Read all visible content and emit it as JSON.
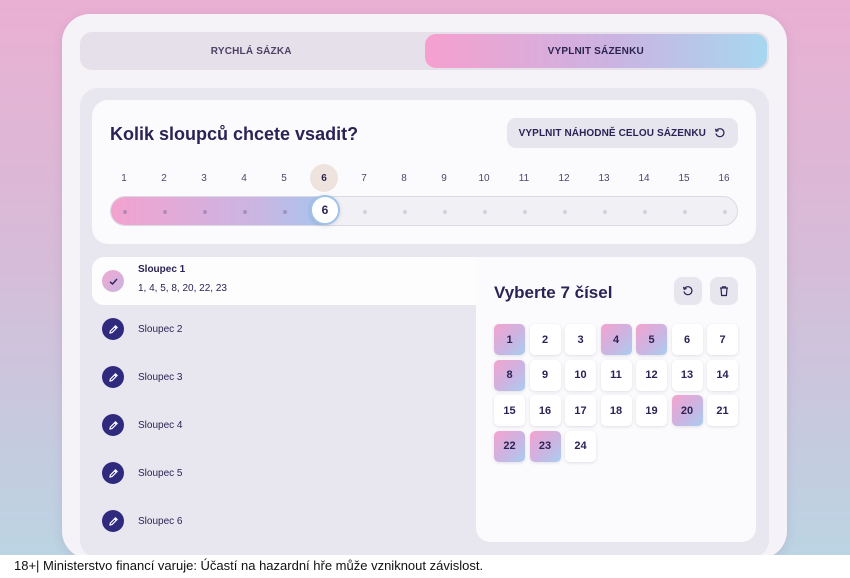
{
  "tabs": [
    {
      "label": "RYCHLÁ SÁZKA",
      "active": false
    },
    {
      "label": "VYPLNIT SÁZENKU",
      "active": true
    }
  ],
  "columns_question": {
    "title": "Kolik sloupců chcete vsadit?",
    "random_button": "VYPLNIT NÁHODNĚ CELOU SÁZENKU",
    "numbers": [
      "1",
      "2",
      "3",
      "4",
      "5",
      "6",
      "7",
      "8",
      "9",
      "10",
      "11",
      "12",
      "13",
      "14",
      "15",
      "16"
    ],
    "selected": 6,
    "selected_label": "6",
    "max": 16
  },
  "column_items": [
    {
      "name": "Sloupec 1",
      "numbers": "1, 4, 5, 8, 20, 22, 23",
      "state": "done",
      "icon": "check-icon"
    },
    {
      "name": "Sloupec 2",
      "state": "edit",
      "icon": "pencil-icon"
    },
    {
      "name": "Sloupec 3",
      "state": "edit",
      "icon": "pencil-icon"
    },
    {
      "name": "Sloupec 4",
      "state": "edit",
      "icon": "pencil-icon"
    },
    {
      "name": "Sloupec 5",
      "state": "edit",
      "icon": "pencil-icon"
    },
    {
      "name": "Sloupec 6",
      "state": "edit",
      "icon": "pencil-icon"
    }
  ],
  "picker": {
    "title": "Vyberte 7 čísel",
    "reset_icon": "reset-icon",
    "delete_icon": "trash-icon",
    "numbers": [
      "1",
      "2",
      "3",
      "4",
      "5",
      "6",
      "7",
      "8",
      "9",
      "10",
      "11",
      "12",
      "13",
      "14",
      "15",
      "16",
      "17",
      "18",
      "19",
      "20",
      "21",
      "22",
      "23",
      "24"
    ],
    "selected": [
      "1",
      "4",
      "5",
      "8",
      "20",
      "22",
      "23"
    ]
  },
  "footer": {
    "warning": "18+| Ministerstvo financí varuje: Účastí na hazardní hře může vzniknout závislost."
  },
  "colors": {
    "accent_pink": "#f4a3cf",
    "accent_blue": "#a9cdef",
    "dark_navy": "#2b2355"
  }
}
